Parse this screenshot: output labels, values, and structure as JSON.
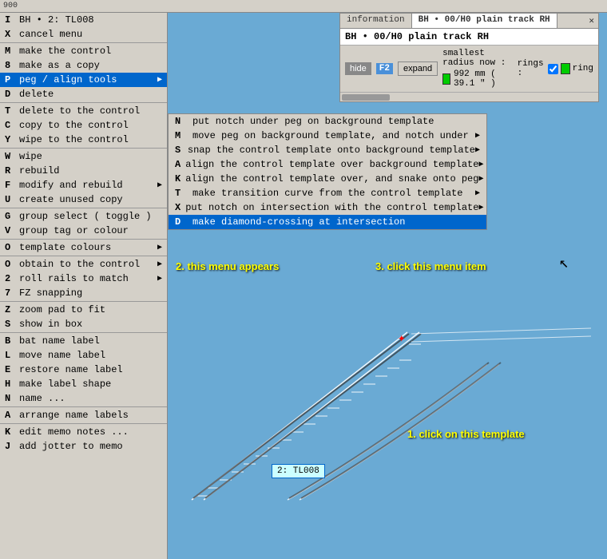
{
  "ruler": {
    "label": "900"
  },
  "info_panel": {
    "tabs": [
      {
        "label": "information",
        "active": false
      },
      {
        "label": "BH • 00/H0 plain track  RH",
        "active": true
      }
    ],
    "close_label": "✕",
    "title": "BH • 00/H0 plain track  RH",
    "hide_btn": "hide",
    "f2_label": "F2",
    "expand_btn": "expand",
    "radius_title": "smallest radius now :",
    "radius_color": "#00cc00",
    "radius_value": "992 mm ( 39.1 \" )",
    "rings_title": "rings :",
    "ring_checked": true,
    "ring_label": "ring"
  },
  "left_menu": {
    "items": [
      {
        "key": "I",
        "label": "BH • 2: TL008",
        "has_arrow": false,
        "separator": false
      },
      {
        "key": "X",
        "label": "cancel menu",
        "has_arrow": false,
        "separator": false
      },
      {
        "key": "",
        "label": "",
        "separator": true,
        "spacer": true
      },
      {
        "key": "M",
        "label": "make the control",
        "has_arrow": false,
        "separator": false
      },
      {
        "key": "8",
        "label": "make as a copy",
        "has_arrow": false,
        "separator": false
      },
      {
        "key": "P",
        "label": "peg / align tools",
        "has_arrow": true,
        "separator": false,
        "active": true
      },
      {
        "key": "D",
        "label": "delete",
        "has_arrow": false,
        "separator": false
      },
      {
        "key": "",
        "label": "",
        "separator": true,
        "spacer": true
      },
      {
        "key": "T",
        "label": "delete to the control",
        "has_arrow": false,
        "separator": false
      },
      {
        "key": "C",
        "label": "copy to the control",
        "has_arrow": false,
        "separator": false
      },
      {
        "key": "Y",
        "label": "wipe to the control",
        "has_arrow": false,
        "separator": false
      },
      {
        "key": "",
        "label": "",
        "separator": true,
        "spacer": true
      },
      {
        "key": "W",
        "label": "wipe",
        "has_arrow": false,
        "separator": false
      },
      {
        "key": "R",
        "label": "rebuild",
        "has_arrow": false,
        "separator": false
      },
      {
        "key": "F",
        "label": "modify and rebuild",
        "has_arrow": true,
        "separator": false
      },
      {
        "key": "U",
        "label": "create  unused copy",
        "has_arrow": false,
        "separator": false
      },
      {
        "key": "",
        "label": "",
        "separator": true,
        "spacer": true
      },
      {
        "key": "G",
        "label": "group select ( toggle )",
        "has_arrow": false,
        "separator": false
      },
      {
        "key": "V",
        "label": "group tag or colour",
        "has_arrow": false,
        "separator": false
      },
      {
        "key": "",
        "label": "",
        "separator": true,
        "spacer": true
      },
      {
        "key": "O",
        "label": "template colours",
        "has_arrow": true,
        "separator": false
      },
      {
        "key": "",
        "label": "",
        "separator": true,
        "spacer": true
      },
      {
        "key": "O",
        "label": "obtain to the control",
        "has_arrow": true,
        "separator": false
      },
      {
        "key": "2",
        "label": "roll rails to match",
        "has_arrow": true,
        "separator": false
      },
      {
        "key": "7",
        "label": "FZ snapping",
        "has_arrow": false,
        "separator": false
      },
      {
        "key": "",
        "label": "",
        "separator": true,
        "spacer": true
      },
      {
        "key": "Z",
        "label": "zoom pad to fit",
        "has_arrow": false,
        "separator": false
      },
      {
        "key": "S",
        "label": "show in box",
        "has_arrow": false,
        "separator": false
      },
      {
        "key": "",
        "label": "",
        "separator": true,
        "spacer": true
      },
      {
        "key": "B",
        "label": "bat name label",
        "has_arrow": false,
        "separator": false
      },
      {
        "key": "L",
        "label": "move name label",
        "has_arrow": false,
        "separator": false
      },
      {
        "key": "E",
        "label": "restore name label",
        "has_arrow": false,
        "separator": false
      },
      {
        "key": "H",
        "label": "make label shape",
        "has_arrow": false,
        "separator": false
      },
      {
        "key": "N",
        "label": "name ...",
        "has_arrow": false,
        "separator": false
      },
      {
        "key": "",
        "label": "",
        "separator": true,
        "spacer": true
      },
      {
        "key": "A",
        "label": "arrange name labels",
        "has_arrow": false,
        "separator": false
      },
      {
        "key": "",
        "label": "",
        "separator": true,
        "spacer": true
      },
      {
        "key": "K",
        "label": "edit memo notes ...",
        "has_arrow": false,
        "separator": false
      },
      {
        "key": "J",
        "label": "add jotter to memo",
        "has_arrow": false,
        "separator": false
      }
    ]
  },
  "submenu": {
    "items": [
      {
        "key": "N",
        "label": "put notch under peg on background template",
        "has_arrow": false
      },
      {
        "key": "M",
        "label": "move peg on background template, and notch under",
        "has_arrow": true
      },
      {
        "key": "S",
        "label": "snap the control template onto background template",
        "has_arrow": true
      },
      {
        "key": "A",
        "label": "align the control template over background template",
        "has_arrow": true
      },
      {
        "key": "K",
        "label": "align the control template over, and snake onto peg",
        "has_arrow": true
      },
      {
        "key": "T",
        "label": "make transition curve from the control template",
        "has_arrow": true
      },
      {
        "key": "X",
        "label": "put notch on intersection with the control template",
        "has_arrow": true
      },
      {
        "key": "D",
        "label": "make diamond-crossing at intersection",
        "has_arrow": false,
        "highlighted": true
      }
    ]
  },
  "annotations": {
    "menu_appears": "2. this menu appears",
    "click_item": "3. click this menu item",
    "click_template": "1. click on this template"
  },
  "template_label": "2: TL008"
}
